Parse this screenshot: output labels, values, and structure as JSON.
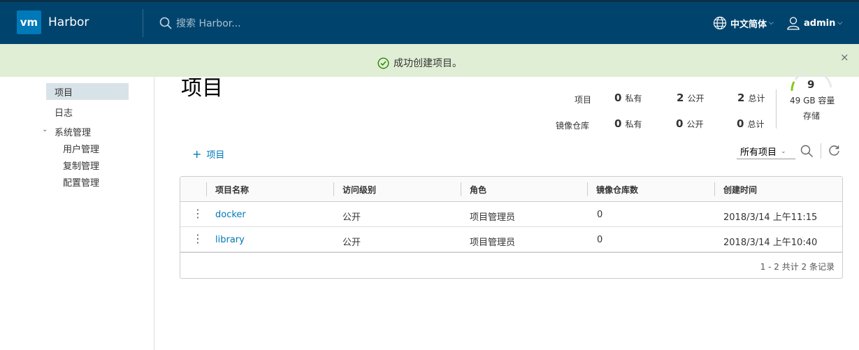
{
  "header": {
    "logo_text": "vm",
    "app_name": "Harbor",
    "search_placeholder": "搜索 Harbor...",
    "language": "中文简体",
    "user": "admin",
    "bg_color": "#00446e"
  },
  "banner": {
    "message": "成功创建项目。",
    "close": "×",
    "bg_color": "#dfeed5"
  },
  "sidebar": {
    "items": [
      {
        "label": "项目",
        "active": true
      },
      {
        "label": "日志"
      },
      {
        "label": "系统管理",
        "expanded": true,
        "children": [
          "用户管理",
          "复制管理",
          "配置管理"
        ]
      }
    ]
  },
  "main": {
    "title": "项目",
    "stats": {
      "projects_label": "项目",
      "repos_label": "镜像仓库",
      "project_private": "0",
      "project_public": "2",
      "project_total": "2",
      "repo_private": "0",
      "repo_public": "0",
      "repo_total": "0",
      "private_label": "私有",
      "public_label": "公开",
      "total_label": "总计"
    },
    "storage": {
      "value": "9",
      "capacity": "49 GB 容量",
      "label": "存储"
    },
    "add_project_label": "项目",
    "filter_selected": "所有项目"
  },
  "table": {
    "columns": [
      "项目名称",
      "访问级别",
      "角色",
      "镜像仓库数",
      "创建时间"
    ],
    "rows": [
      {
        "name": "docker",
        "access": "公开",
        "role": "项目管理员",
        "repos": "0",
        "created": "2018/3/14 上午11:15"
      },
      {
        "name": "library",
        "access": "公开",
        "role": "项目管理员",
        "repos": "0",
        "created": "2018/3/14 上午10:40"
      }
    ],
    "footer": "1 - 2 共计 2 条记录"
  }
}
